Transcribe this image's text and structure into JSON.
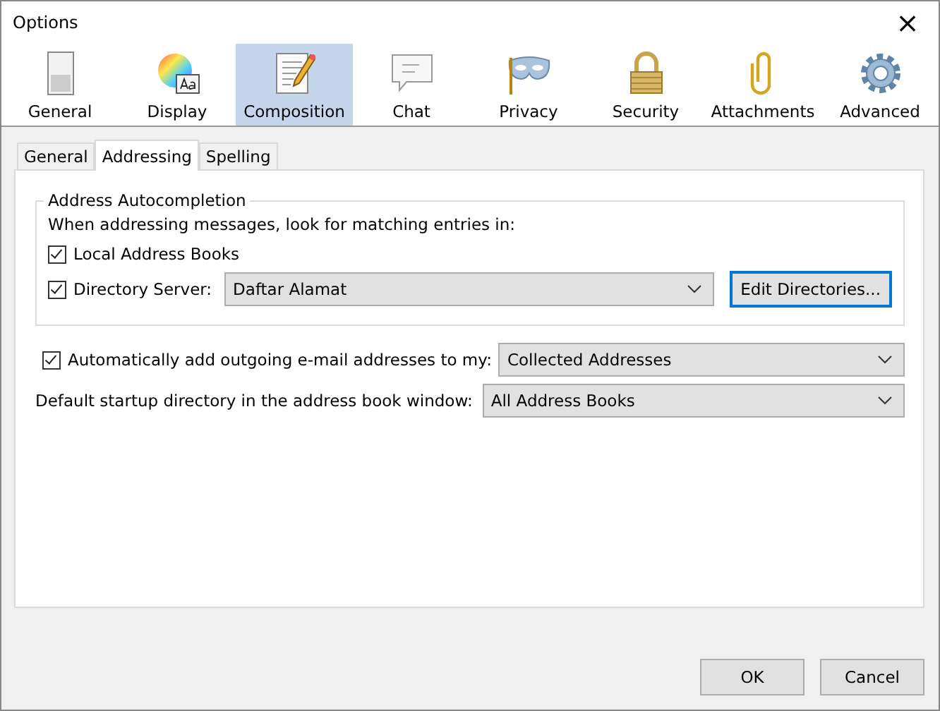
{
  "window": {
    "title": "Options",
    "close": "×"
  },
  "toolbar": [
    {
      "label": "General",
      "kind": "switch",
      "selected": false
    },
    {
      "label": "Display",
      "kind": "palette",
      "selected": false
    },
    {
      "label": "Composition",
      "kind": "pencil",
      "selected": true
    },
    {
      "label": "Chat",
      "kind": "bubble",
      "selected": false
    },
    {
      "label": "Privacy",
      "kind": "mask",
      "selected": false
    },
    {
      "label": "Security",
      "kind": "lock",
      "selected": false
    },
    {
      "label": "Attachments",
      "kind": "clip",
      "selected": false
    },
    {
      "label": "Advanced",
      "kind": "gear",
      "selected": false
    }
  ],
  "tabs": [
    {
      "label": "General",
      "selected": false
    },
    {
      "label": "Addressing",
      "selected": true
    },
    {
      "label": "Spelling",
      "selected": false
    }
  ],
  "autocompletion": {
    "title": "Address Autocompletion",
    "intro": "When addressing messages, look for matching entries in:",
    "local": {
      "label": "Local Address Books",
      "checked": true
    },
    "directory": {
      "label": "Directory Server:",
      "checked": true,
      "value": "Daftar Alamat"
    },
    "edit_button": "Edit Directories..."
  },
  "auto_add": {
    "label": "Automatically add outgoing e-mail addresses to my:",
    "checked": true,
    "value": "Collected Addresses"
  },
  "startup": {
    "label": "Default startup directory in the address book window:",
    "value": "All Address Books"
  },
  "buttons": [
    "OK",
    "Cancel"
  ]
}
